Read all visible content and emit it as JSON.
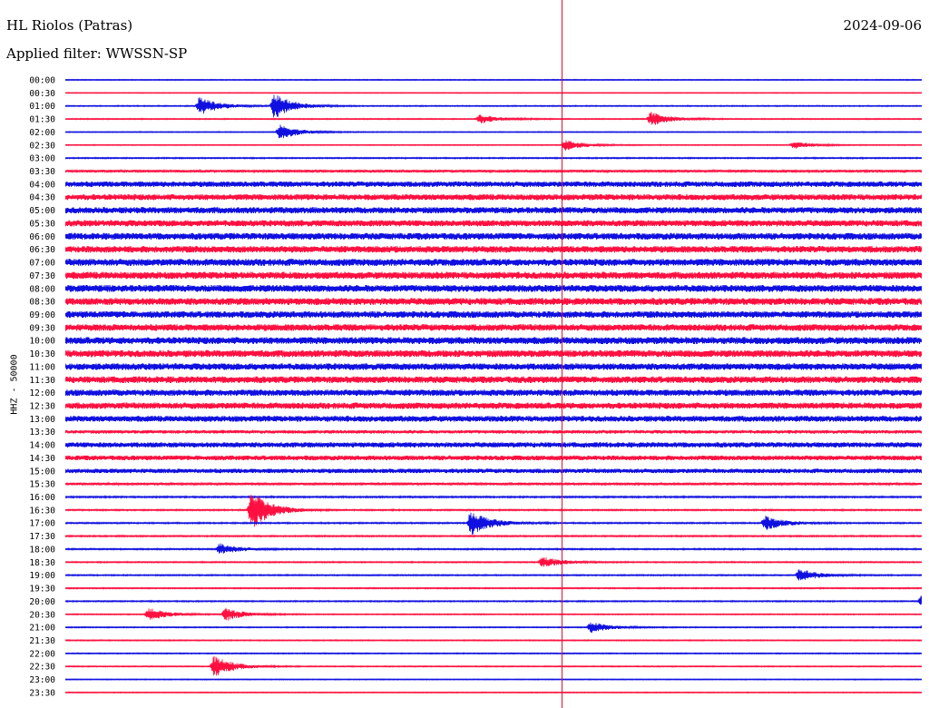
{
  "header": {
    "station": "HL Riolos (Patras)",
    "filter": "Applied filter: WWSSN-SP",
    "date": "2024-09-06"
  },
  "axis": {
    "channel_label": "HHZ - 50000"
  },
  "colors": {
    "trace_a": "#1010e0",
    "trace_b": "#ff1040",
    "marker": "#e01030"
  },
  "chart_data": {
    "type": "line",
    "title": "HL Riolos (Patras)",
    "subtitle": "Applied filter: WWSSN-SP",
    "ylabel": "HHZ - 50000",
    "row_labels": [
      "00:00",
      "00:30",
      "01:00",
      "01:30",
      "02:00",
      "02:30",
      "03:00",
      "03:30",
      "04:00",
      "04:30",
      "05:00",
      "05:30",
      "06:00",
      "06:30",
      "07:00",
      "07:30",
      "08:00",
      "08:30",
      "09:00",
      "09:30",
      "10:00",
      "10:30",
      "11:00",
      "11:30",
      "12:00",
      "12:30",
      "13:00",
      "13:30",
      "14:00",
      "14:30",
      "15:00",
      "15:30",
      "16:00",
      "16:30",
      "17:00",
      "17:30",
      "18:00",
      "18:30",
      "19:00",
      "19:30",
      "20:00",
      "20:30",
      "21:00",
      "21:30",
      "22:00",
      "22:30",
      "23:00",
      "23:30"
    ],
    "noise_level": [
      0.5,
      0.4,
      0.6,
      0.6,
      0.5,
      0.5,
      0.7,
      1.5,
      3.0,
      3.2,
      3.4,
      3.4,
      3.6,
      3.6,
      3.8,
      3.8,
      3.8,
      3.8,
      3.6,
      3.6,
      3.8,
      3.8,
      3.6,
      3.6,
      3.4,
      3.4,
      3.2,
      2.0,
      2.8,
      2.6,
      2.4,
      1.4,
      0.9,
      0.8,
      0.8,
      0.8,
      0.8,
      0.7,
      0.7,
      0.7,
      0.7,
      0.6,
      0.6,
      0.6,
      0.6,
      0.6,
      0.5,
      0.5
    ],
    "events": [
      {
        "row": 2,
        "minute": 4.7,
        "amp": 10
      },
      {
        "row": 2,
        "minute": 7.3,
        "amp": 14
      },
      {
        "row": 3,
        "minute": 14.5,
        "amp": 5
      },
      {
        "row": 3,
        "minute": 20.5,
        "amp": 8
      },
      {
        "row": 4,
        "minute": 7.5,
        "amp": 8
      },
      {
        "row": 5,
        "minute": 17.5,
        "amp": 6
      },
      {
        "row": 5,
        "minute": 25.5,
        "amp": 4
      },
      {
        "row": 33,
        "minute": 6.5,
        "amp": 22
      },
      {
        "row": 34,
        "minute": 14.2,
        "amp": 14
      },
      {
        "row": 34,
        "minute": 24.5,
        "amp": 8
      },
      {
        "row": 36,
        "minute": 5.4,
        "amp": 6
      },
      {
        "row": 37,
        "minute": 16.7,
        "amp": 6
      },
      {
        "row": 38,
        "minute": 25.7,
        "amp": 7
      },
      {
        "row": 40,
        "minute": 30.0,
        "amp": 8
      },
      {
        "row": 41,
        "minute": 2.9,
        "amp": 7
      },
      {
        "row": 41,
        "minute": 5.6,
        "amp": 7
      },
      {
        "row": 42,
        "minute": 18.4,
        "amp": 6
      },
      {
        "row": 42,
        "minute": 30.1,
        "amp": 6
      },
      {
        "row": 45,
        "minute": 5.2,
        "amp": 12
      }
    ],
    "marker_minute": 17.4
  }
}
